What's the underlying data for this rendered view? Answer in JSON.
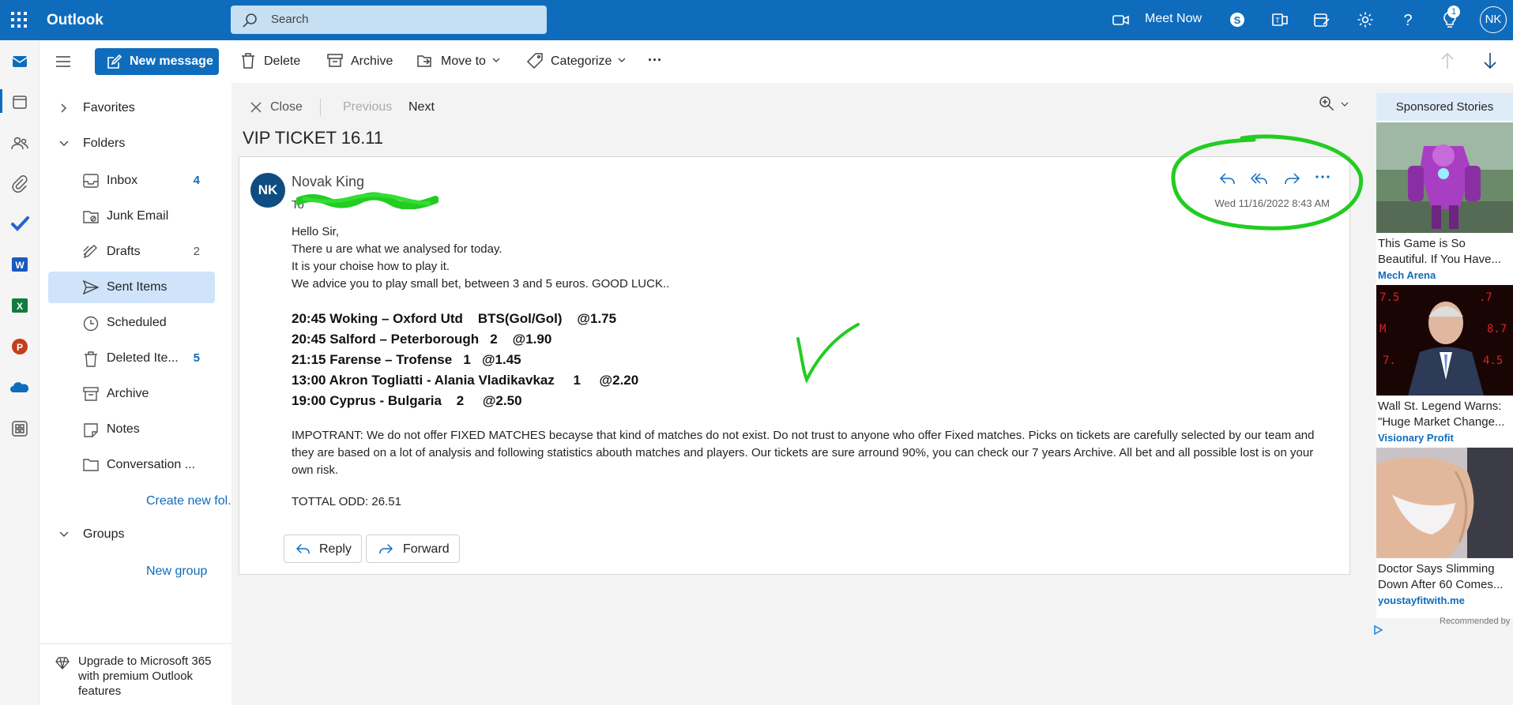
{
  "topbar": {
    "app_name": "Outlook",
    "search_placeholder": "Search",
    "meet_now": "Meet Now",
    "notification_count": "1",
    "avatar_initials": "NK",
    "icons": [
      "waffle-icon",
      "search-icon",
      "video-icon",
      "skype-icon",
      "teams-icon",
      "my-day-icon",
      "gear-icon",
      "help-icon",
      "tips-icon"
    ]
  },
  "rail": {
    "items": [
      "mail-icon",
      "calendar-icon",
      "people-icon",
      "files-icon",
      "todo-icon",
      "word-icon",
      "excel-icon",
      "powerpoint-icon",
      "onedrive-icon",
      "apps-icon"
    ]
  },
  "toolbar": {
    "new_message": "New message",
    "delete": "Delete",
    "archive": "Archive",
    "move_to": "Move to",
    "categorize": "Categorize",
    "more": "···"
  },
  "folders": {
    "favorites": "Favorites",
    "folders_label": "Folders",
    "items": [
      {
        "label": "Inbox",
        "count": "4"
      },
      {
        "label": "Junk Email",
        "count": ""
      },
      {
        "label": "Drafts",
        "count": "2"
      },
      {
        "label": "Sent Items",
        "count": ""
      },
      {
        "label": "Scheduled",
        "count": ""
      },
      {
        "label": "Deleted Ite...",
        "count": "5"
      },
      {
        "label": "Archive",
        "count": ""
      },
      {
        "label": "Notes",
        "count": ""
      },
      {
        "label": "Conversation ...",
        "count": ""
      }
    ],
    "create_new": "Create new fol...",
    "groups": "Groups",
    "new_group": "New group",
    "upgrade": "Upgrade to Microsoft 365 with premium Outlook features"
  },
  "reading": {
    "close": "Close",
    "previous": "Previous",
    "next": "Next",
    "subject": "VIP TICKET 16.11",
    "sender_initials": "NK",
    "sender_name": "Novak King",
    "to_label": "To",
    "date": "Wed 11/16/2022 8:43 AM",
    "body_lines": [
      "Hello Sir,",
      "There u are what we analysed for today.",
      "It is your choise how to play it.",
      "We advice you to play small bet, between 3 and 5 euros. GOOD LUCK.."
    ],
    "picks": [
      "20:45 Woking – Oxford Utd    BTS(Gol/Gol)    @1.75",
      "20:45 Salford – Peterborough   2    @1.90",
      "21:15 Farense – Trofense   1   @1.45",
      "13:00 Akron Togliatti - Alania Vladikavkaz     1     @2.20",
      "19:00 Cyprus - Bulgaria    2     @2.50"
    ],
    "important": "IMPOTRANT: We do not offer FIXED MATCHES becayse that kind of matches do not exist. Do not trust to anyone who offer Fixed matches. Picks on tickets are carefully selected by our team and they are based on a lot of analysis and following statistics abouth matches and players. Our tickets are sure arround 90%, you can check our 7 years Archive. All bet and all possible lost is on your own risk.",
    "total": "TOTTAL ODD: 26.51",
    "reply": "Reply",
    "forward": "Forward"
  },
  "ads": {
    "header": "Sponsored Stories",
    "items": [
      {
        "title": "This Game is So Beautiful. If You Have...",
        "source": "Mech Arena"
      },
      {
        "title": "Wall St. Legend Warns: \"Huge Market Change...",
        "source": "Visionary Profit"
      },
      {
        "title": "Doctor Says Slimming Down After 60 Comes...",
        "source": "youstayfitwith.me"
      }
    ],
    "recommended": "Recommended by"
  },
  "colors": {
    "brand": "#0f6cbd",
    "selected": "#cfe4fa",
    "annotation_green": "#22cc22"
  }
}
